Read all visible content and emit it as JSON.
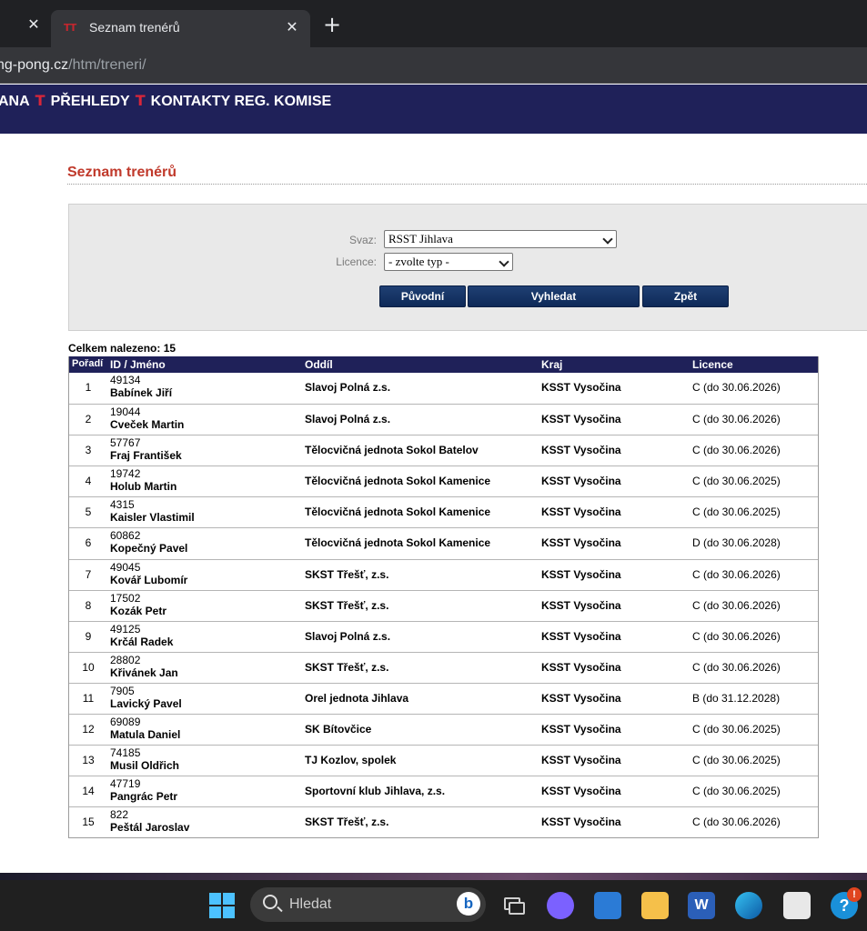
{
  "browser": {
    "prev_tab_close": "✕",
    "tab_title": "Seznam trenérů",
    "tab_close": "✕",
    "new_tab": "+",
    "url_host": "ng-pong.cz",
    "url_path": "/htm/treneri/"
  },
  "nav": {
    "items": [
      "ANA",
      "PŘEHLEDY",
      "KONTAKTY REG. KOMISE"
    ],
    "separator": "T"
  },
  "page": {
    "title": "Seznam trenérů"
  },
  "filter": {
    "svaz_label": "Svaz:",
    "svaz_value": "RSST Jihlava",
    "licence_label": "Licence:",
    "licence_value": "- zvolte typ -",
    "btn_puvodni": "Původní",
    "btn_vyhledat": "Vyhledat",
    "btn_zpet": "Zpět"
  },
  "results": {
    "count_text": "Celkem nalezeno: 15",
    "headers": [
      "Pořadí",
      "ID / Jméno",
      "Oddíl",
      "Kraj",
      "Licence"
    ],
    "rows": [
      {
        "no": "1",
        "id": "49134",
        "name": "Babínek Jiří",
        "club": "Slavoj Polná z.s.",
        "kraj": "KSST Vysočina",
        "licence": "C (do 30.06.2026)"
      },
      {
        "no": "2",
        "id": "19044",
        "name": "Cveček Martin",
        "club": "Slavoj Polná z.s.",
        "kraj": "KSST Vysočina",
        "licence": "C (do 30.06.2026)"
      },
      {
        "no": "3",
        "id": "57767",
        "name": "Fraj František",
        "club": "Tělocvičná jednota Sokol Batelov",
        "kraj": "KSST Vysočina",
        "licence": "C (do 30.06.2026)"
      },
      {
        "no": "4",
        "id": "19742",
        "name": "Holub Martin",
        "club": "Tělocvičná jednota Sokol Kamenice",
        "kraj": "KSST Vysočina",
        "licence": "C (do 30.06.2025)"
      },
      {
        "no": "5",
        "id": "4315",
        "name": "Kaisler Vlastimil",
        "club": "Tělocvičná jednota Sokol Kamenice",
        "kraj": "KSST Vysočina",
        "licence": "C (do 30.06.2025)"
      },
      {
        "no": "6",
        "id": "60862",
        "name": "Kopečný Pavel",
        "club": "Tělocvičná jednota Sokol Kamenice",
        "kraj": "KSST Vysočina",
        "licence": "D (do 30.06.2028)"
      },
      {
        "no": "7",
        "id": "49045",
        "name": "Kovář Lubomír",
        "club": "SKST Třešť, z.s.",
        "kraj": "KSST Vysočina",
        "licence": "C (do 30.06.2026)"
      },
      {
        "no": "8",
        "id": "17502",
        "name": "Kozák Petr",
        "club": "SKST Třešť, z.s.",
        "kraj": "KSST Vysočina",
        "licence": "C (do 30.06.2026)"
      },
      {
        "no": "9",
        "id": "49125",
        "name": "Krčál Radek",
        "club": "Slavoj Polná z.s.",
        "kraj": "KSST Vysočina",
        "licence": "C (do 30.06.2026)"
      },
      {
        "no": "10",
        "id": "28802",
        "name": "Křivánek Jan",
        "club": "SKST Třešť, z.s.",
        "kraj": "KSST Vysočina",
        "licence": "C (do 30.06.2026)"
      },
      {
        "no": "11",
        "id": "7905",
        "name": "Lavický Pavel",
        "club": "Orel jednota Jihlava",
        "kraj": "KSST Vysočina",
        "licence": "B (do 31.12.2028)"
      },
      {
        "no": "12",
        "id": "69089",
        "name": "Matula Daniel",
        "club": "SK Bítovčice",
        "kraj": "KSST Vysočina",
        "licence": "C (do 30.06.2025)"
      },
      {
        "no": "13",
        "id": "74185",
        "name": "Musil Oldřich",
        "club": "TJ Kozlov, spolek",
        "kraj": "KSST Vysočina",
        "licence": "C (do 30.06.2025)"
      },
      {
        "no": "14",
        "id": "47719",
        "name": "Pangrác Petr",
        "club": "Sportovní klub Jihlava, z.s.",
        "kraj": "KSST Vysočina",
        "licence": "C (do 30.06.2025)"
      },
      {
        "no": "15",
        "id": "822",
        "name": "Peštál Jaroslav",
        "club": "SKST Třešť, z.s.",
        "kraj": "KSST Vysočina",
        "licence": "C (do 30.06.2026)"
      }
    ]
  },
  "taskbar": {
    "search_text": "Hledat",
    "bing_glyph": "b",
    "word_glyph": "W",
    "help_glyph": "?",
    "notification_badge": "!",
    "icons": [
      "windows-start-icon",
      "search-icon",
      "bing-icon",
      "task-view-icon",
      "chat-icon",
      "widgets-icon",
      "file-explorer-icon",
      "word-icon",
      "edge-icon",
      "store-icon",
      "help-icon"
    ]
  },
  "colors": {
    "nav_bg": "#1f2159",
    "title_red": "#c0392b",
    "nav_separator": "#d7263a",
    "button_blue": "#0e2a58"
  }
}
